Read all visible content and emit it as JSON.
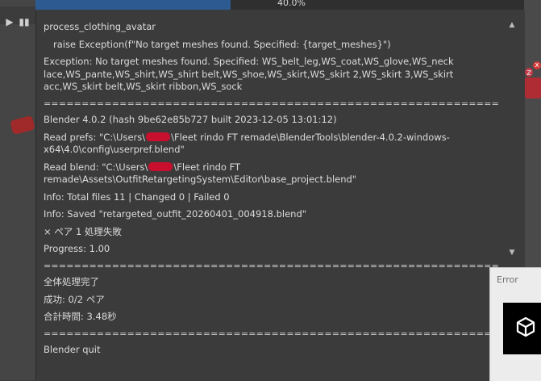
{
  "progress": {
    "label": "40.0%",
    "fraction": 0.4
  },
  "log": {
    "lines": [
      "process_clothing_avatar",
      "raise Exception(f\"No target meshes found. Specified: {target_meshes}\")",
      "Exception: No target meshes found. Specified: WS_belt_leg,WS_coat,WS_glove,WS_neck lace,WS_pante,WS_shirt,WS_shirt belt,WS_shoe,WS_skirt,WS_skirt 2,WS_skirt 3,WS_skirt acc,WS_skirt belt,WS_skirt ribbon,WS_sock",
      "============================================================",
      "Blender 4.0.2 (hash 9be62e85b727 built 2023-12-05 13:01:12)",
      "Read prefs: \"C:\\Users\\",
      "\\Fleet rindo FT remade\\BlenderTools\\blender-4.0.2-windows-x64\\4.0\\config\\userpref.blend\"",
      "Read blend: \"C:\\Users\\",
      "\\Fleet rindo FT remade\\Assets\\OutfitRetargetingSystem\\Editor\\base_project.blend\"",
      "Info: Total files 11 | Changed 0 | Failed 0",
      "Info: Saved \"retargeted_outfit_20260401_004918.blend\"",
      "× ペア 1 処理失敗",
      "Progress: 1.00",
      "============================================================",
      "全体処理完了",
      "成功: 0/2 ペア",
      "合計時間: 3.48秒",
      "============================================================",
      "Blender quit"
    ]
  },
  "error_popup": {
    "title": "Error",
    "icon": "unity-logo-icon"
  },
  "colors": {
    "panel_bg": "#3b3b3b",
    "text": "#dcdcdc",
    "progress_fill": "#2d5b91",
    "redaction": "#c8102e"
  }
}
